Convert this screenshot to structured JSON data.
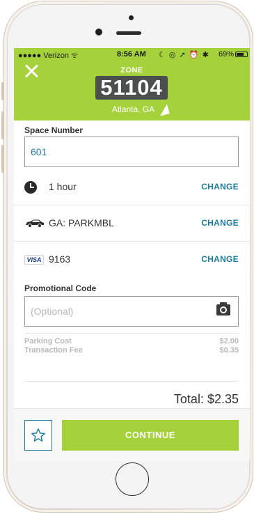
{
  "status_bar": {
    "carrier": "●●●●● Verizon ᯤ",
    "time": "8:56 AM",
    "icons": "☾ ◎ ➚ ⏰ ✱",
    "battery": "69%"
  },
  "header": {
    "zone_label": "ZONE",
    "zone_number": "51104",
    "city": "Atlanta, GA"
  },
  "space": {
    "label": "Space Number",
    "value": "601"
  },
  "duration": {
    "value": "1 hour",
    "change_label": "CHANGE"
  },
  "vehicle": {
    "value": "GA: PARKMBL",
    "change_label": "CHANGE"
  },
  "payment": {
    "card_brand": "VISA",
    "value": "9163",
    "change_label": "CHANGE"
  },
  "promo": {
    "label": "Promotional Code",
    "placeholder": "(Optional)"
  },
  "costs": {
    "parking_label": "Parking Cost",
    "parking_amount": "$2.00",
    "fee_label": "Transaction Fee",
    "fee_amount": "$0.35",
    "total": "Total: $2.35"
  },
  "footer": {
    "continue_label": "CONTINUE"
  },
  "colors": {
    "brand_green": "#a5d23a",
    "accent_blue": "#1e7ea0",
    "zone_box": "#4a4f4d"
  }
}
